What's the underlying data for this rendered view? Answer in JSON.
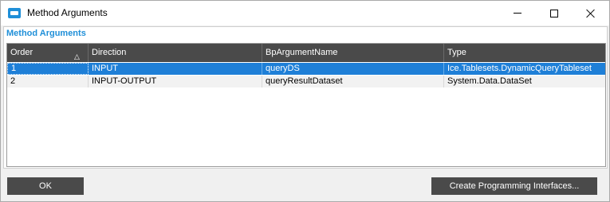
{
  "window": {
    "title": "Method Arguments"
  },
  "panel": {
    "title": "Method Arguments"
  },
  "grid": {
    "columns": [
      "Order",
      "Direction",
      "BpArgumentName",
      "Type"
    ],
    "sort_icon": "sort-ascending-icon",
    "rows": [
      [
        "1",
        "INPUT",
        "queryDS",
        "Ice.Tablesets.DynamicQueryTableset"
      ],
      [
        "2",
        "INPUT-OUTPUT",
        "queryResultDataset",
        "System.Data.DataSet"
      ]
    ],
    "selected_row": 0
  },
  "buttons": {
    "ok": "OK",
    "create": "Create Programming Interfaces..."
  },
  "colors": {
    "accent": "#1f8fd8",
    "header_bg": "#4a4a4a",
    "selection": "#1e7fd7"
  }
}
